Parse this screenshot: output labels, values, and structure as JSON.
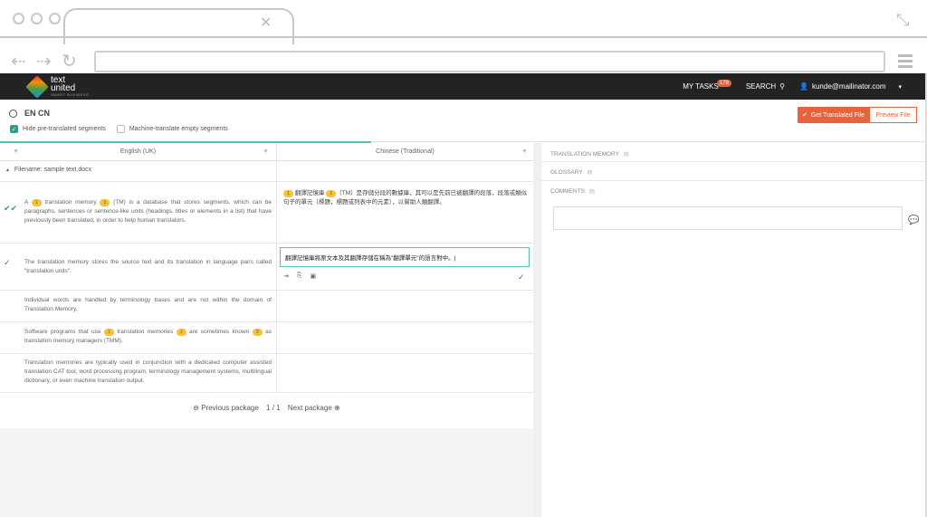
{
  "header": {
    "logo_line1": "text",
    "logo_line2": "united",
    "logo_tag": "SMART BUSINESS",
    "my_tasks": "MY TASKS",
    "tasks_count": "178",
    "search": "SEARCH",
    "user": "kunde@mailinator.com"
  },
  "toolbar": {
    "lang_pair": "EN CN",
    "hide_pretranslated": "Hide pre-translated segments",
    "machine_translate": "Machine-translate empty segments",
    "get_file": "Get Translated File",
    "preview_file": "Preview File"
  },
  "columns": {
    "source": "English (UK)",
    "target": "Chinese (Traditional)"
  },
  "filename": "Filename: sample text.docx",
  "segments": [
    {
      "src_a": "A ",
      "src_tag1": "1",
      "src_b": " translation memory ",
      "src_tag2": "1",
      "src_c": " (TM) is a database that stores segments, which can be paragraphs, sentences or sentence-like units (headings, titles or elements in a list) that have previously been translated, in order to help human translators.",
      "tgt_tag1": "1",
      "tgt_a": " 翻譯記憶庫 ",
      "tgt_tag2": "1",
      "tgt_b": "（TM）是存儲分段的數據庫，其可以是先前已被翻譯的段落，段落或類似句子的單元（標題，標題或列表中的元素），以幫助人類翻譯。"
    },
    {
      "src": "The translation memory stores the source text and its translation in language pairs called \"translation units\".",
      "tgt": "翻譯記憶庫將原文本及其翻譯存儲在稱為\"翻譯單元\"的語言對中。|"
    },
    {
      "src": "Individual words are handled by terminology bases and are not within the domain of Translation Memory."
    },
    {
      "src_a": "Software programs that use ",
      "src_tag1": "1",
      "src_b": " translation memories ",
      "src_tag2": "1",
      "src_c": " are sometimes known ",
      "src_tag3": "2",
      "src_d": " as translation memory managers (TMM)."
    },
    {
      "src": "Translation memories are typically used in conjunction with a dedicated computer assisted translation CAT tool, word processing program, terminology management systems, multilingual dictionary, or even machine translation output."
    }
  ],
  "pager": {
    "prev": "Previous package",
    "page": "1 / 1",
    "next": "Next package"
  },
  "right_panel": {
    "tm": "TRANSLATION MEMORY",
    "glossary": "GLOSSARY",
    "comments": "COMMENTS"
  },
  "colors": {
    "accent": "#e8623b",
    "teal": "#53c2b6",
    "tag": "#f5c33b"
  }
}
